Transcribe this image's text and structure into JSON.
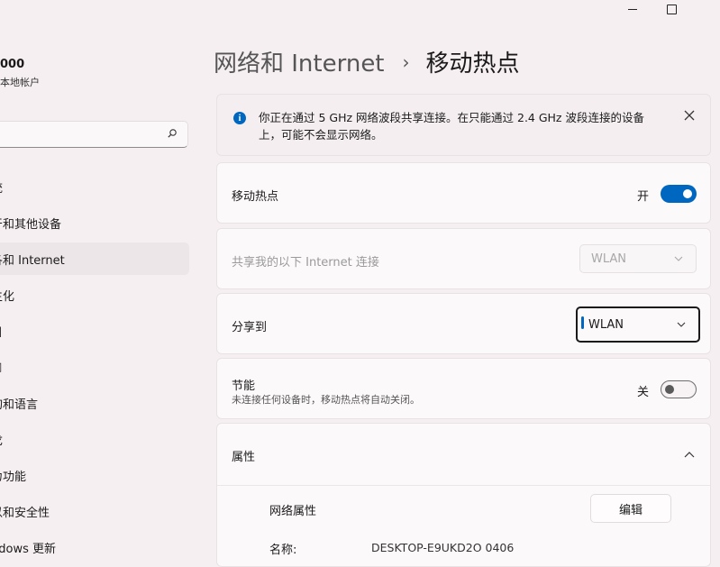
{
  "window": {
    "minimize_icon": "minimize-icon",
    "maximize_icon": "maximize-icon"
  },
  "sidebar": {
    "user_name": "000",
    "user_sub": "本地帐户",
    "search_placeholder": "",
    "items": [
      {
        "label": "统",
        "active": false
      },
      {
        "label": "牙和其他设备",
        "active": false
      },
      {
        "label": "各和 Internet",
        "active": true
      },
      {
        "label": "生化",
        "active": false
      },
      {
        "label": "目",
        "active": false
      },
      {
        "label": "□",
        "active": false
      },
      {
        "label": "旬和语言",
        "active": false
      },
      {
        "label": "戈",
        "active": false
      },
      {
        "label": "力功能",
        "active": false
      },
      {
        "label": "以和安全性",
        "active": false
      },
      {
        "label": "ndows 更新",
        "active": false
      }
    ]
  },
  "header": {
    "crumb": "网络和 Internet",
    "separator": "›",
    "current": "移动热点"
  },
  "info": {
    "text": "你正在通过 5 GHz 网络波段共享连接。在只能通过 2.4 GHz 波段连接的设备上，可能不会显示网络。"
  },
  "hotspot": {
    "label": "移动热点",
    "state_text": "开",
    "on": true
  },
  "share_from": {
    "label": "共享我的以下 Internet 连接",
    "value": "WLAN"
  },
  "share_to": {
    "label": "分享到",
    "value": "WLAN"
  },
  "power_saving": {
    "label": "节能",
    "description": "未连接任何设备时，移动热点将自动关闭。",
    "state_text": "关",
    "on": false
  },
  "properties": {
    "label": "属性",
    "network_props_label": "网络属性",
    "edit_label": "编辑",
    "name_label": "名称:",
    "name_value": "DESKTOP-E9UKD2O 0406"
  },
  "colors": {
    "accent": "#0067c0",
    "background": "#f6eff2"
  }
}
